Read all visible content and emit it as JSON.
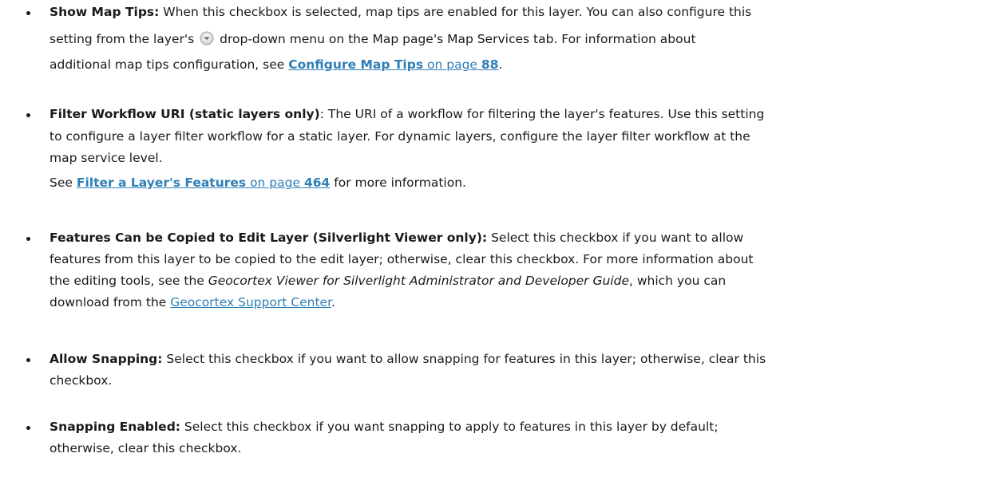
{
  "items": [
    {
      "term": "Show Map Tips:",
      "l1_rest": " When this checkbox is selected, map tips are enabled for this layer. You can also configure this",
      "l2_pre": "setting from the layer's",
      "l2_post": "drop-down menu on the Map page's Map Services tab. For information about",
      "l3": "additional map tips configuration, see",
      "link": "Configure Map Tips",
      "on_page": "on page",
      "page": "88",
      "end": "."
    },
    {
      "term": "Filter Workflow URI (static layers only)",
      "l1_rest": ": The URI of a workflow for filtering the layer's features. Use this setting",
      "l2": "to configure a layer filter workflow for a static layer. For dynamic layers, configure the layer filter workflow at the",
      "l3": "map service level.",
      "see": "See",
      "link": "Filter a Layer's Features",
      "on_page": "on page",
      "page": "464",
      "end": "for more information."
    },
    {
      "term": "Features Can be Copied to Edit Layer (Silverlight Viewer only):",
      "l1_rest": " Select this checkbox if you want to allow",
      "l2": "features from this layer to be copied to the edit layer; otherwise, clear this checkbox. For more information about",
      "l3_pre": "the editing tools, see the",
      "guide": "Geocortex Viewer for Silverlight Administrator and Developer Guide",
      "l3_post": ", which you can",
      "l4_pre": "download from the",
      "link": "Geocortex Support Center",
      "end": "."
    },
    {
      "term": "Allow Snapping:",
      "l1_rest": " Select this checkbox if you want to allow snapping for features in this layer; otherwise, clear this",
      "l2": "checkbox."
    },
    {
      "term": "Snapping Enabled:",
      "l1_rest": " Select this checkbox if you want snapping to apply to features in this layer by default;",
      "l2": "otherwise, clear this checkbox."
    }
  ],
  "icons": {
    "dropdown": "dropdown-circle-icon"
  },
  "colors": {
    "link": "#2e7fb6",
    "text": "#1a1a1a"
  }
}
